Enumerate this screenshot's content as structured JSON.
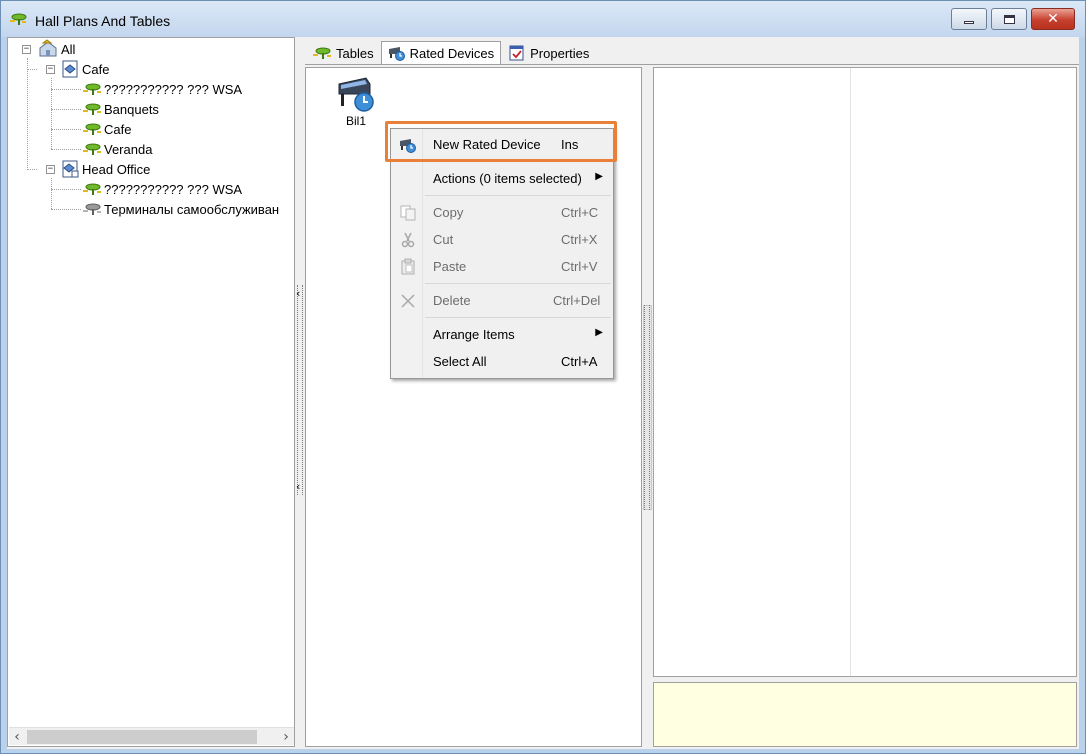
{
  "window": {
    "title": "Hall Plans And Tables"
  },
  "tree": {
    "root": "All",
    "groups": [
      {
        "label": "Cafe",
        "children": [
          "??????????? ??? WSA",
          "Banquets",
          "Cafe",
          "Veranda"
        ]
      },
      {
        "label": "Head Office",
        "children": [
          "??????????? ??? WSA",
          "Терминалы самообслуживан"
        ]
      }
    ],
    "selected": "Veranda"
  },
  "tabs": [
    {
      "label": "Tables",
      "icon": "table-icon"
    },
    {
      "label": "Rated Devices",
      "icon": "rated-device-icon",
      "active": true
    },
    {
      "label": "Properties",
      "icon": "properties-icon"
    }
  ],
  "center": {
    "device_label": "Bil1"
  },
  "context_menu": {
    "items": [
      {
        "label": "New Rated Device",
        "shortcut": "Ins",
        "icon": "rated-device-icon",
        "disabled": false
      },
      {
        "label": "Actions (0 items selected)",
        "shortcut": "",
        "submenu": true,
        "disabled": false
      },
      {
        "label": "Copy",
        "shortcut": "Ctrl+C",
        "icon": "copy-icon",
        "disabled": true
      },
      {
        "label": "Cut",
        "shortcut": "Ctrl+X",
        "icon": "cut-icon",
        "disabled": true
      },
      {
        "label": "Paste",
        "shortcut": "Ctrl+V",
        "icon": "paste-icon",
        "disabled": true
      },
      {
        "label": "Delete",
        "shortcut": "Ctrl+Del",
        "icon": "delete-icon",
        "disabled": true
      },
      {
        "label": "Arrange Items",
        "shortcut": "",
        "submenu": true,
        "disabled": false
      },
      {
        "label": "Select All",
        "shortcut": "Ctrl+A",
        "disabled": false
      }
    ]
  },
  "colors": {
    "highlight_border": "#e8803a",
    "info_panel_bg": "#ffffe1",
    "titlebar_bg": "#c3d6ee"
  }
}
